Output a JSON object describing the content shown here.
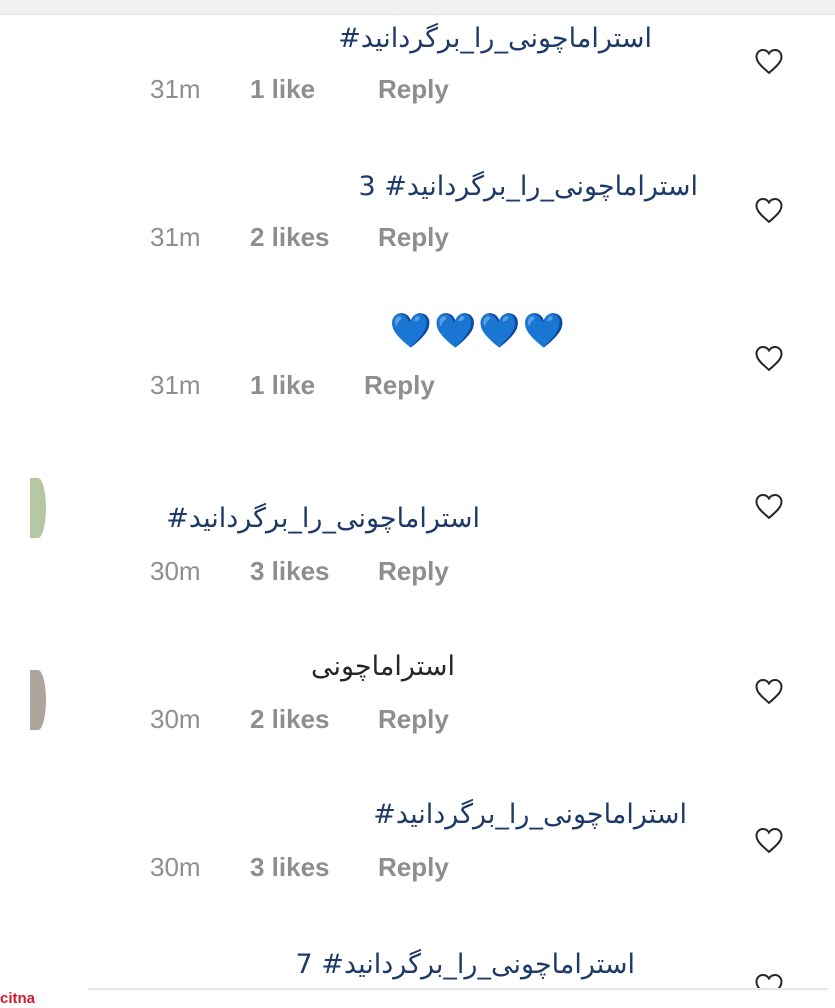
{
  "comments": [
    {
      "text": "استراماچونی_را_برگردانید#",
      "time": "31m",
      "likes": "1 like",
      "reply": "Reply",
      "style": "hashtag"
    },
    {
      "text": "استراماچونی_را_برگردانید# 3",
      "time": "31m",
      "likes": "2 likes",
      "reply": "Reply",
      "style": "hashtag"
    },
    {
      "text": "💙💙💙💙",
      "time": "31m",
      "likes": "1 like",
      "reply": "Reply",
      "style": "hearts"
    },
    {
      "text": "استراماچونی_را_برگردانید#",
      "time": "30m",
      "likes": "3 likes",
      "reply": "Reply",
      "style": "hashtag"
    },
    {
      "text": "استراماچونی",
      "time": "30m",
      "likes": "2 likes",
      "reply": "Reply",
      "style": "plain"
    },
    {
      "text": "استراماچونی_را_برگردانید#",
      "time": "30m",
      "likes": "3 likes",
      "reply": "Reply",
      "style": "hashtag"
    },
    {
      "text": "استراماچونی_را_برگردانید# 7",
      "time": "",
      "likes": "",
      "reply": "",
      "style": "hashtag"
    }
  ],
  "icons": {
    "like": "heart-outline-icon"
  },
  "colors": {
    "hashtag": "#1e3a67",
    "meta": "#8e8e8e",
    "heart_blue": "#2d8fe0"
  },
  "watermark": "citna"
}
